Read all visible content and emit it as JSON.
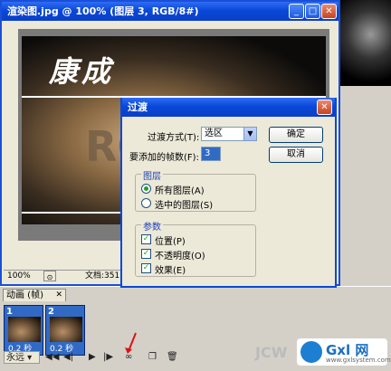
{
  "document_window": {
    "title": "渲染图.jpg @ 100% (图层 3, RGB/8#)",
    "zoom": "100%",
    "doc_info": "文档:351.6"
  },
  "artwork": {
    "logo_text": "康成",
    "bg_text": "RGB"
  },
  "animation_panel": {
    "tab_label": "动画 (帧)",
    "frames": [
      {
        "number": "1",
        "delay": "0.2 秒"
      },
      {
        "number": "2",
        "delay": "0.2 秒"
      }
    ],
    "loop_label": "永远"
  },
  "dialog": {
    "title": "过渡",
    "tween_with_label": "过渡方式(T):",
    "tween_with_value": "选区",
    "frames_to_add_label": "要添加的帧数(F):",
    "frames_to_add_value": "3",
    "ok_label": "确定",
    "cancel_label": "取消",
    "layers_group": "图层",
    "all_layers_label": "所有图层(A)",
    "selected_layers_label": "选中的图层(S)",
    "params_group": "参数",
    "position_label": "位置(P)",
    "opacity_label": "不透明度(O)",
    "effects_label": "效果(E)"
  },
  "watermark": {
    "brand": "Gxl 网",
    "url": "www.gxlsystem.com",
    "left_text": "JCW"
  }
}
